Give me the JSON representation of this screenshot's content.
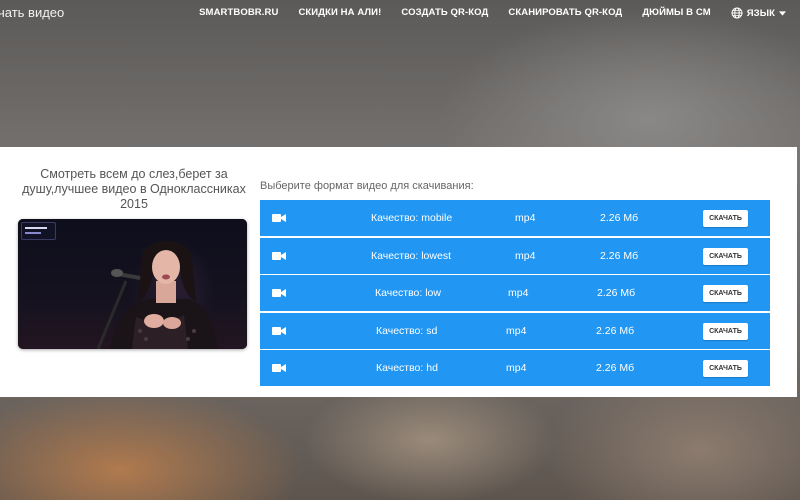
{
  "header": {
    "brand": "чать видео",
    "nav": [
      "SMARTBOBR.RU",
      "СКИДКИ НА АЛИ!",
      "СОЗДАТЬ QR-КОД",
      "СКАНИРОВАТЬ QR-КОД",
      "ДЮЙМЫ В СМ"
    ],
    "language_label": "ЯЗЫК"
  },
  "video": {
    "title": "Смотреть всем до слез,берет за душу,лучшее видео в Одноклассниках 2015"
  },
  "formats": {
    "prompt": "Выберите формат видео для скачивания:",
    "download_label": "СКАЧАТЬ",
    "rows": [
      {
        "quality": "Качество: mobile",
        "format": "mp4",
        "size": "2.26 Мб"
      },
      {
        "quality": "Качество: lowest",
        "format": "mp4",
        "size": "2.26 Мб"
      },
      {
        "quality": "Качество: low",
        "format": "mp4",
        "size": "2.26 Мб"
      },
      {
        "quality": "Качество: sd",
        "format": "mp4",
        "size": "2.26 Мб"
      },
      {
        "quality": "Качество: hd",
        "format": "mp4",
        "size": "2.26 Мб"
      }
    ]
  },
  "icons": {
    "row_icon": "video-camera-icon",
    "language_icon": "globe-icon",
    "dropdown_icon": "caret-down-icon"
  },
  "colors": {
    "accent": "#2196f3",
    "panel": "#ffffff"
  }
}
